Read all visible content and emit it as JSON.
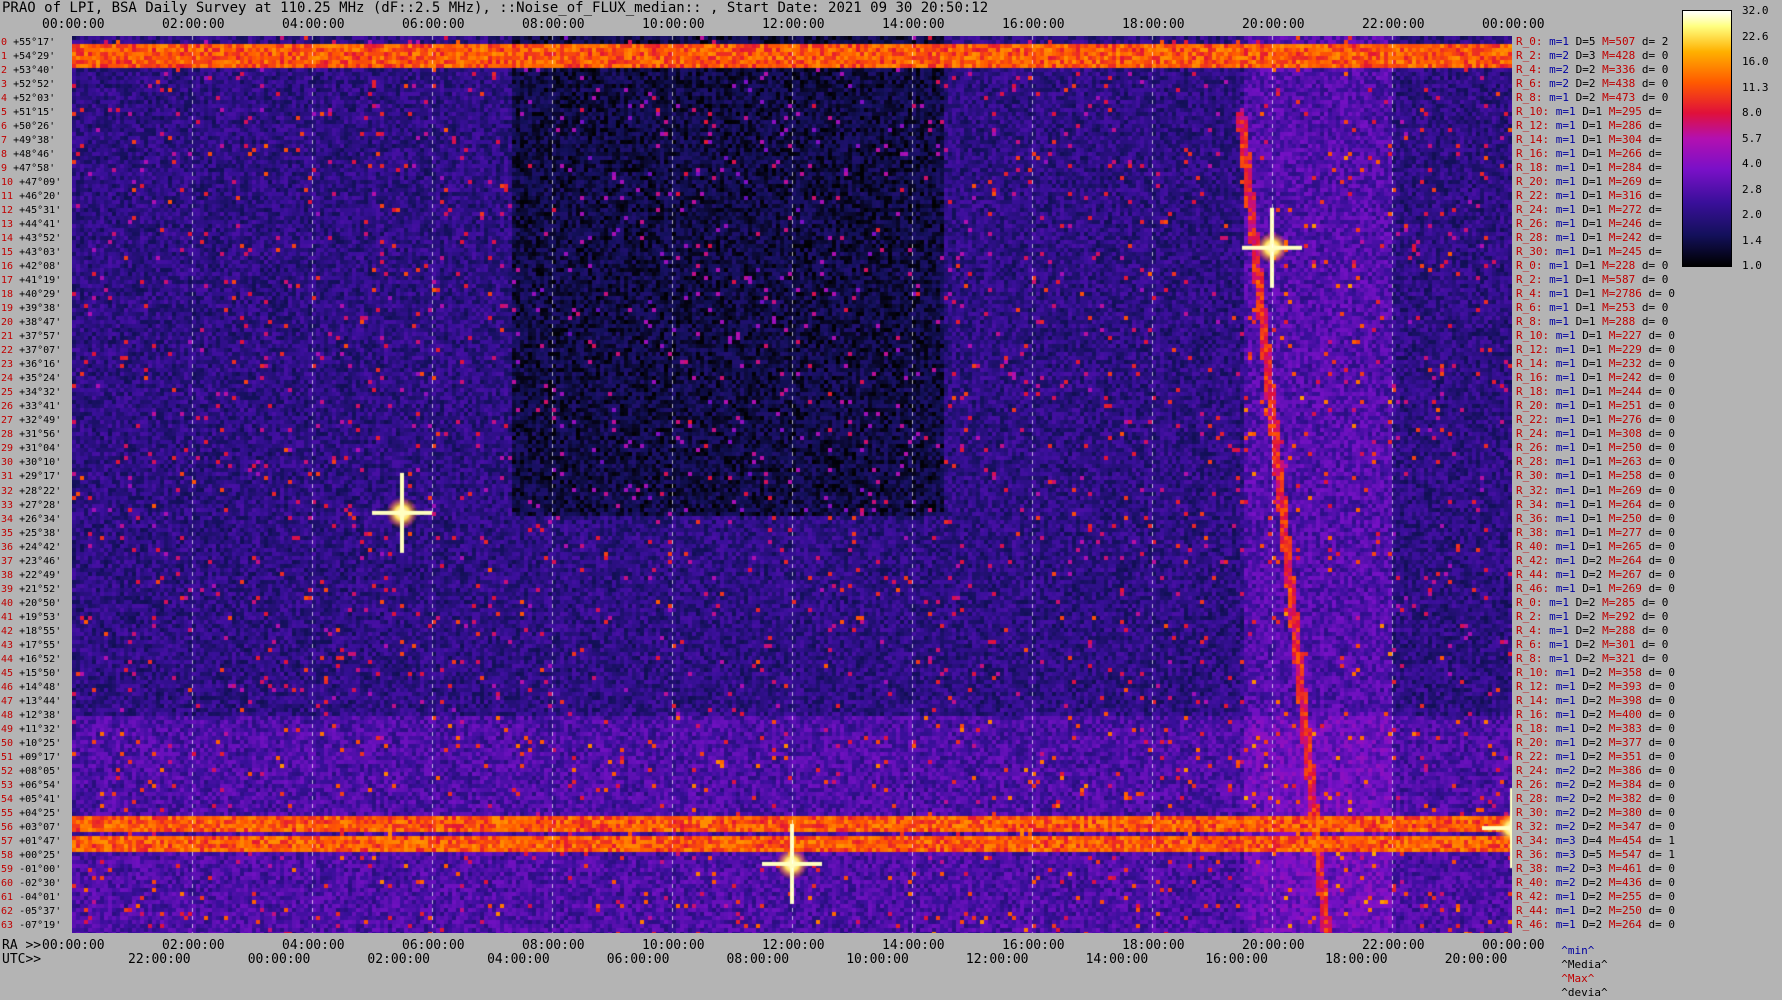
{
  "title": "PRAO of LPI, BSA Daily Survey at 110.25 MHz (dF::2.5 MHz), ::Noise_of_FLUX_median:: , Start Date: 2021 09 30 20:50:12",
  "top_axis": [
    "00:00:00",
    "02:00:00",
    "04:00:00",
    "06:00:00",
    "08:00:00",
    "10:00:00",
    "12:00:00",
    "14:00:00",
    "16:00:00",
    "18:00:00",
    "20:00:00",
    "22:00:00",
    "00:00:00"
  ],
  "ra_axis": {
    "label": "RA >>",
    "ticks": [
      "00:00:00",
      "02:00:00",
      "04:00:00",
      "06:00:00",
      "08:00:00",
      "10:00:00",
      "12:00:00",
      "14:00:00",
      "16:00:00",
      "18:00:00",
      "20:00:00",
      "22:00:00",
      "00:00:00"
    ]
  },
  "utc_axis": {
    "label": "UTC>>",
    "ticks": [
      "22:00:00",
      "00:00:00",
      "02:00:00",
      "04:00:00",
      "06:00:00",
      "08:00:00",
      "10:00:00",
      "12:00:00",
      "14:00:00",
      "16:00:00",
      "18:00:00",
      "20:00:00"
    ]
  },
  "colorbar": {
    "ticks": [
      "32.0",
      "22.6",
      "16.0",
      "11.3",
      "8.0",
      "5.7",
      "4.0",
      "2.8",
      "2.0",
      "1.4",
      "1.0"
    ],
    "colors": [
      "#000000",
      "#13105a",
      "#3a0f9a",
      "#7a10c8",
      "#b310b0",
      "#e0103a",
      "#ff5a00",
      "#ffb000",
      "#ffff80",
      "#ffffff"
    ]
  },
  "rows": [
    {
      "n": "0",
      "dec": "+55°17'"
    },
    {
      "n": "1",
      "dec": "+54°29'"
    },
    {
      "n": "2",
      "dec": "+53°40'"
    },
    {
      "n": "3",
      "dec": "+52°52'"
    },
    {
      "n": "4",
      "dec": "+52°03'"
    },
    {
      "n": "5",
      "dec": "+51°15'"
    },
    {
      "n": "6",
      "dec": "+50°26'"
    },
    {
      "n": "7",
      "dec": "+49°38'"
    },
    {
      "n": "8",
      "dec": "+48°46'"
    },
    {
      "n": "9",
      "dec": "+47°58'"
    },
    {
      "n": "10",
      "dec": "+47°09'"
    },
    {
      "n": "11",
      "dec": "+46°20'"
    },
    {
      "n": "12",
      "dec": "+45°31'"
    },
    {
      "n": "13",
      "dec": "+44°41'"
    },
    {
      "n": "14",
      "dec": "+43°52'"
    },
    {
      "n": "15",
      "dec": "+43°03'"
    },
    {
      "n": "16",
      "dec": "+42°08'"
    },
    {
      "n": "17",
      "dec": "+41°19'"
    },
    {
      "n": "18",
      "dec": "+40°29'"
    },
    {
      "n": "19",
      "dec": "+39°38'"
    },
    {
      "n": "20",
      "dec": "+38°47'"
    },
    {
      "n": "21",
      "dec": "+37°57'"
    },
    {
      "n": "22",
      "dec": "+37°07'"
    },
    {
      "n": "23",
      "dec": "+36°16'"
    },
    {
      "n": "24",
      "dec": "+35°24'"
    },
    {
      "n": "25",
      "dec": "+34°32'"
    },
    {
      "n": "26",
      "dec": "+33°41'"
    },
    {
      "n": "27",
      "dec": "+32°49'"
    },
    {
      "n": "28",
      "dec": "+31°56'"
    },
    {
      "n": "29",
      "dec": "+31°04'"
    },
    {
      "n": "30",
      "dec": "+30°10'"
    },
    {
      "n": "31",
      "dec": "+29°17'"
    },
    {
      "n": "32",
      "dec": "+28°22'"
    },
    {
      "n": "33",
      "dec": "+27°28'"
    },
    {
      "n": "34",
      "dec": "+26°34'"
    },
    {
      "n": "35",
      "dec": "+25°38'"
    },
    {
      "n": "36",
      "dec": "+24°42'"
    },
    {
      "n": "37",
      "dec": "+23°46'"
    },
    {
      "n": "38",
      "dec": "+22°49'"
    },
    {
      "n": "39",
      "dec": "+21°52'"
    },
    {
      "n": "40",
      "dec": "+20°50'"
    },
    {
      "n": "41",
      "dec": "+19°53'"
    },
    {
      "n": "42",
      "dec": "+18°55'"
    },
    {
      "n": "43",
      "dec": "+17°55'"
    },
    {
      "n": "44",
      "dec": "+16°52'"
    },
    {
      "n": "45",
      "dec": "+15°50'"
    },
    {
      "n": "46",
      "dec": "+14°48'"
    },
    {
      "n": "47",
      "dec": "+13°44'"
    },
    {
      "n": "48",
      "dec": "+12°38'"
    },
    {
      "n": "49",
      "dec": "+11°32'"
    },
    {
      "n": "50",
      "dec": "+10°25'"
    },
    {
      "n": "51",
      "dec": "+09°17'"
    },
    {
      "n": "52",
      "dec": "+08°05'"
    },
    {
      "n": "53",
      "dec": "+06°54'"
    },
    {
      "n": "54",
      "dec": "+05°41'"
    },
    {
      "n": "55",
      "dec": "+04°25'"
    },
    {
      "n": "56",
      "dec": "+03°07'"
    },
    {
      "n": "57",
      "dec": "+01°47'"
    },
    {
      "n": "58",
      "dec": "+00°25'"
    },
    {
      "n": "59",
      "dec": "-01°00'"
    },
    {
      "n": "60",
      "dec": "-02°30'"
    },
    {
      "n": "61",
      "dec": "-04°01'"
    },
    {
      "n": "62",
      "dec": "-05°37'"
    },
    {
      "n": "63",
      "dec": "-07°19'"
    }
  ],
  "right_labels": [
    {
      "r": "R_0:",
      "m": "m=1",
      "d": "D=5",
      "h": "M=507",
      "dv": "d= 2"
    },
    {
      "r": "R_2:",
      "m": "m=2",
      "d": "D=3",
      "h": "M=428",
      "dv": "d= 0"
    },
    {
      "r": "R_4:",
      "m": "m=2",
      "d": "D=2",
      "h": "M=336",
      "dv": "d= 0"
    },
    {
      "r": "R_6:",
      "m": "m=2",
      "d": "D=2",
      "h": "M=438",
      "dv": "d= 0"
    },
    {
      "r": "R_8:",
      "m": "m=1",
      "d": "D=2",
      "h": "M=473",
      "dv": "d= 0"
    },
    {
      "r": "R_10:",
      "m": "m=1",
      "d": "D=1",
      "h": "M=295",
      "dv": "d="
    },
    {
      "r": "R_12:",
      "m": "m=1",
      "d": "D=1",
      "h": "M=286",
      "dv": "d="
    },
    {
      "r": "R_14:",
      "m": "m=1",
      "d": "D=1",
      "h": "M=304",
      "dv": "d="
    },
    {
      "r": "R_16:",
      "m": "m=1",
      "d": "D=1",
      "h": "M=266",
      "dv": "d="
    },
    {
      "r": "R_18:",
      "m": "m=1",
      "d": "D=1",
      "h": "M=284",
      "dv": "d="
    },
    {
      "r": "R_20:",
      "m": "m=1",
      "d": "D=1",
      "h": "M=269",
      "dv": "d="
    },
    {
      "r": "R_22:",
      "m": "m=1",
      "d": "D=1",
      "h": "M=316",
      "dv": "d="
    },
    {
      "r": "R_24:",
      "m": "m=1",
      "d": "D=1",
      "h": "M=272",
      "dv": "d="
    },
    {
      "r": "R_26:",
      "m": "m=1",
      "d": "D=1",
      "h": "M=246",
      "dv": "d="
    },
    {
      "r": "R_28:",
      "m": "m=1",
      "d": "D=1",
      "h": "M=242",
      "dv": "d="
    },
    {
      "r": "R_30:",
      "m": "m=1",
      "d": "D=1",
      "h": "M=245",
      "dv": "d="
    },
    {
      "r": "R_0:",
      "m": "m=1",
      "d": "D=1",
      "h": "M=228",
      "dv": "d= 0"
    },
    {
      "r": "R_2:",
      "m": "m=1",
      "d": "D=1",
      "h": "M=587",
      "dv": "d= 0"
    },
    {
      "r": "R_4:",
      "m": "m=1",
      "d": "D=1",
      "h": "M=2786",
      "dv": "d= 0"
    },
    {
      "r": "R_6:",
      "m": "m=1",
      "d": "D=1",
      "h": "M=253",
      "dv": "d= 0"
    },
    {
      "r": "R_8:",
      "m": "m=1",
      "d": "D=1",
      "h": "M=288",
      "dv": "d= 0"
    },
    {
      "r": "R_10:",
      "m": "m=1",
      "d": "D=1",
      "h": "M=227",
      "dv": "d= 0"
    },
    {
      "r": "R_12:",
      "m": "m=1",
      "d": "D=1",
      "h": "M=229",
      "dv": "d= 0"
    },
    {
      "r": "R_14:",
      "m": "m=1",
      "d": "D=1",
      "h": "M=232",
      "dv": "d= 0"
    },
    {
      "r": "R_16:",
      "m": "m=1",
      "d": "D=1",
      "h": "M=242",
      "dv": "d= 0"
    },
    {
      "r": "R_18:",
      "m": "m=1",
      "d": "D=1",
      "h": "M=244",
      "dv": "d= 0"
    },
    {
      "r": "R_20:",
      "m": "m=1",
      "d": "D=1",
      "h": "M=251",
      "dv": "d= 0"
    },
    {
      "r": "R_22:",
      "m": "m=1",
      "d": "D=1",
      "h": "M=276",
      "dv": "d= 0"
    },
    {
      "r": "R_24:",
      "m": "m=1",
      "d": "D=1",
      "h": "M=308",
      "dv": "d= 0"
    },
    {
      "r": "R_26:",
      "m": "m=1",
      "d": "D=1",
      "h": "M=250",
      "dv": "d= 0"
    },
    {
      "r": "R_28:",
      "m": "m=1",
      "d": "D=1",
      "h": "M=263",
      "dv": "d= 0"
    },
    {
      "r": "R_30:",
      "m": "m=1",
      "d": "D=1",
      "h": "M=258",
      "dv": "d= 0"
    },
    {
      "r": "R_32:",
      "m": "m=1",
      "d": "D=1",
      "h": "M=269",
      "dv": "d= 0"
    },
    {
      "r": "R_34:",
      "m": "m=1",
      "d": "D=1",
      "h": "M=264",
      "dv": "d= 0"
    },
    {
      "r": "R_36:",
      "m": "m=1",
      "d": "D=1",
      "h": "M=250",
      "dv": "d= 0"
    },
    {
      "r": "R_38:",
      "m": "m=1",
      "d": "D=1",
      "h": "M=277",
      "dv": "d= 0"
    },
    {
      "r": "R_40:",
      "m": "m=1",
      "d": "D=1",
      "h": "M=265",
      "dv": "d= 0"
    },
    {
      "r": "R_42:",
      "m": "m=1",
      "d": "D=2",
      "h": "M=264",
      "dv": "d= 0"
    },
    {
      "r": "R_44:",
      "m": "m=1",
      "d": "D=2",
      "h": "M=267",
      "dv": "d= 0"
    },
    {
      "r": "R_46:",
      "m": "m=1",
      "d": "D=1",
      "h": "M=269",
      "dv": "d= 0"
    },
    {
      "r": "R_0:",
      "m": "m=1",
      "d": "D=2",
      "h": "M=285",
      "dv": "d= 0"
    },
    {
      "r": "R_2:",
      "m": "m=1",
      "d": "D=2",
      "h": "M=292",
      "dv": "d= 0"
    },
    {
      "r": "R_4:",
      "m": "m=1",
      "d": "D=2",
      "h": "M=288",
      "dv": "d= 0"
    },
    {
      "r": "R_6:",
      "m": "m=1",
      "d": "D=2",
      "h": "M=301",
      "dv": "d= 0"
    },
    {
      "r": "R_8:",
      "m": "m=1",
      "d": "D=2",
      "h": "M=321",
      "dv": "d= 0"
    },
    {
      "r": "R_10:",
      "m": "m=1",
      "d": "D=2",
      "h": "M=358",
      "dv": "d= 0"
    },
    {
      "r": "R_12:",
      "m": "m=1",
      "d": "D=2",
      "h": "M=393",
      "dv": "d= 0"
    },
    {
      "r": "R_14:",
      "m": "m=1",
      "d": "D=2",
      "h": "M=398",
      "dv": "d= 0"
    },
    {
      "r": "R_16:",
      "m": "m=1",
      "d": "D=2",
      "h": "M=400",
      "dv": "d= 0"
    },
    {
      "r": "R_18:",
      "m": "m=1",
      "d": "D=2",
      "h": "M=383",
      "dv": "d= 0"
    },
    {
      "r": "R_20:",
      "m": "m=1",
      "d": "D=2",
      "h": "M=377",
      "dv": "d= 0"
    },
    {
      "r": "R_22:",
      "m": "m=1",
      "d": "D=2",
      "h": "M=351",
      "dv": "d= 0"
    },
    {
      "r": "R_24:",
      "m": "m=2",
      "d": "D=2",
      "h": "M=386",
      "dv": "d= 0"
    },
    {
      "r": "R_26:",
      "m": "m=2",
      "d": "D=2",
      "h": "M=384",
      "dv": "d= 0"
    },
    {
      "r": "R_28:",
      "m": "m=2",
      "d": "D=2",
      "h": "M=382",
      "dv": "d= 0"
    },
    {
      "r": "R_30:",
      "m": "m=2",
      "d": "D=2",
      "h": "M=380",
      "dv": "d= 0"
    },
    {
      "r": "R_32:",
      "m": "m=2",
      "d": "D=2",
      "h": "M=347",
      "dv": "d= 0"
    },
    {
      "r": "R_34:",
      "m": "m=3",
      "d": "D=4",
      "h": "M=454",
      "dv": "d= 1"
    },
    {
      "r": "R_36:",
      "m": "m=3",
      "d": "D=5",
      "h": "M=547",
      "dv": "d= 1"
    },
    {
      "r": "R_38:",
      "m": "m=2",
      "d": "D=3",
      "h": "M=461",
      "dv": "d= 0"
    },
    {
      "r": "R_40:",
      "m": "m=2",
      "d": "D=2",
      "h": "M=436",
      "dv": "d= 0"
    },
    {
      "r": "R_42:",
      "m": "m=1",
      "d": "D=2",
      "h": "M=255",
      "dv": "d= 0"
    },
    {
      "r": "R_44:",
      "m": "m=1",
      "d": "D=2",
      "h": "M=250",
      "dv": "d= 0"
    },
    {
      "r": "R_46:",
      "m": "m=1",
      "d": "D=2",
      "h": "M=264",
      "dv": "d= 0"
    }
  ],
  "legend": {
    "min": "^min^",
    "median": "^Media^",
    "max": "^Max^",
    "dev": "^devia^"
  },
  "chart_data": {
    "type": "heatmap",
    "title": "PRAO of LPI, BSA Daily Survey at 110.25 MHz (dF::2.5 MHz), ::Noise_of_FLUX_median:: , Start Date: 2021 09 30 20:50:12",
    "x_ra_hours": [
      0,
      24
    ],
    "y_declination_deg": [
      55.28,
      -7.32
    ],
    "scale": "log",
    "value_range": [
      1.0,
      32.0
    ],
    "bright_features": [
      {
        "ra_hours": 20.0,
        "dec_deg": 40.5,
        "value": 32.0
      },
      {
        "ra_hours": 12.0,
        "dec_deg": -2.5,
        "value": 32.0
      },
      {
        "ra_hours": 5.5,
        "dec_deg": 22.0,
        "value": 22.6
      },
      {
        "ra_hours": 24.0,
        "dec_deg": 0.0,
        "value": 16.0
      }
    ],
    "bright_bands_dec_deg": [
      54.5,
      53.7,
      0.4,
      -1.0
    ],
    "grid": true
  }
}
